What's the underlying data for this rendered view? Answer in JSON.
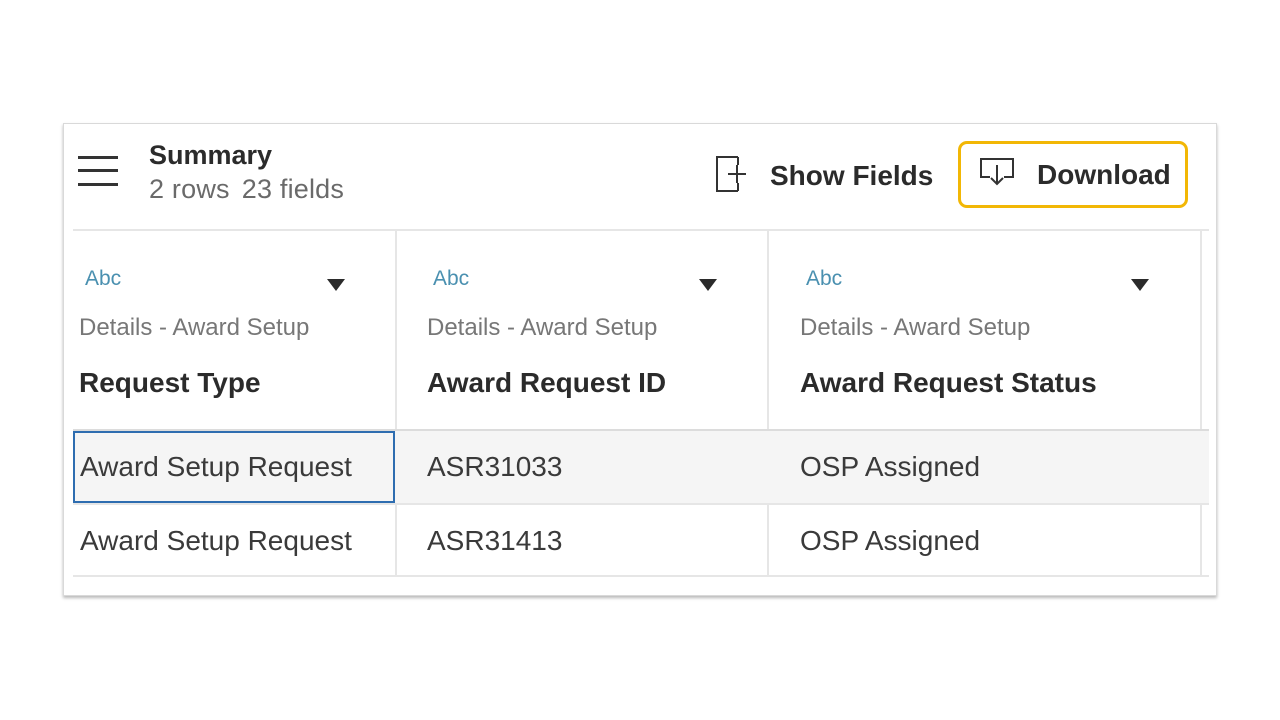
{
  "header": {
    "title": "Summary",
    "row_count": "2 rows",
    "field_count": "23 fields",
    "show_fields_label": "Show Fields",
    "download_label": "Download"
  },
  "columns": [
    {
      "type": "Abc",
      "source": "Details - Award Setup",
      "name": "Request Type"
    },
    {
      "type": "Abc",
      "source": "Details - Award Setup",
      "name": "Award Request ID"
    },
    {
      "type": "Abc",
      "source": "Details - Award Setup",
      "name": "Award Request Status"
    }
  ],
  "rows": [
    [
      "Award Setup Request",
      "ASR31033",
      "OSP Assigned"
    ],
    [
      "Award Setup Request",
      "ASR31413",
      "OSP Assigned"
    ]
  ],
  "colors": {
    "download_highlight": "#f2b705",
    "selected_cell_border": "#2e6db0",
    "type_label": "#4a90b0",
    "row_alt_bg": "#f5f5f5"
  },
  "icons": {
    "menu": "hamburger-menu-icon",
    "show_fields": "add-field-icon",
    "download": "download-icon",
    "dropdown": "caret-down-icon"
  }
}
